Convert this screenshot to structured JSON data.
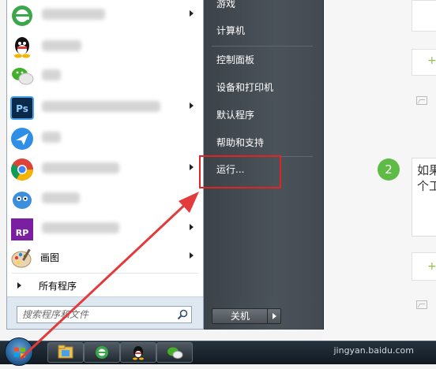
{
  "start_menu": {
    "programs": [
      {
        "icon": "ie-icon",
        "label": ""
      },
      {
        "icon": "qq-icon",
        "label": ""
      },
      {
        "icon": "wechat-icon",
        "label": ""
      },
      {
        "icon": "photoshop-icon",
        "label": ""
      },
      {
        "icon": "feishu-icon",
        "label": ""
      },
      {
        "icon": "chrome-icon",
        "label": ""
      },
      {
        "icon": "bird-icon",
        "label": ""
      },
      {
        "icon": "axure-rp-icon",
        "label": ""
      },
      {
        "icon": "paint-icon",
        "label": "画图"
      }
    ],
    "ps_text": "Ps",
    "rp_text": "RP",
    "all_programs": "所有程序",
    "search_placeholder": "搜索程序和文件",
    "right_items": [
      "游戏",
      "计算机",
      "控制面板",
      "设备和打印机",
      "默认程序",
      "帮助和支持",
      "运行..."
    ],
    "shutdown_label": "关机"
  },
  "taskbar": {
    "items": [
      "explorer-icon",
      "ie-icon",
      "qq-icon",
      "wechat-icon"
    ]
  },
  "background_page": {
    "step_number": "2",
    "step_text_line1": "如果",
    "step_text_line2": "个工",
    "watermark": "jingyan.baidu.com"
  },
  "colors": {
    "highlight_border": "#e02424",
    "arrow": "#e33b3b",
    "step_badge": "#5dbb46"
  }
}
